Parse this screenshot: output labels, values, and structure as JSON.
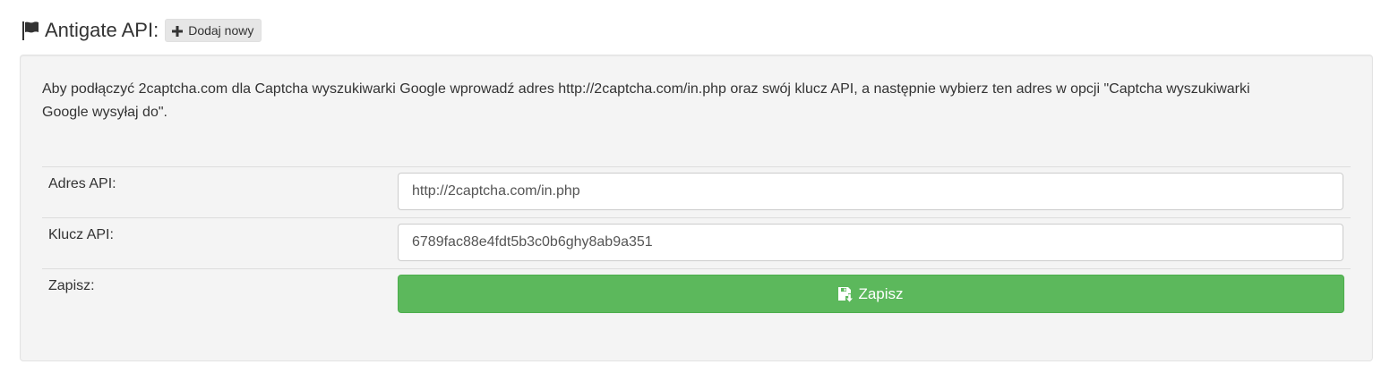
{
  "header": {
    "title": "Antigate API:",
    "add_button_label": "Dodaj nowy",
    "flag_icon": "flag-icon",
    "plus_icon": "plus-icon"
  },
  "panel": {
    "description": "Aby podłączyć 2captcha.com dla Captcha wyszukiwarki Google wprowadź adres http://2captcha.com/in.php oraz swój klucz API, a następnie wybierz ten adres w opcji \"Captcha wyszukiwarki Google wysyłaj do\".",
    "api_address": {
      "label": "Adres API:",
      "value": "http://2captcha.com/in.php"
    },
    "api_key": {
      "label": "Klucz API:",
      "value": "6789fac88e4fdt5b3c0b6ghy8ab9a351"
    },
    "save": {
      "label": "Zapisz:",
      "button_label": "Zapisz",
      "icon": "save-icon"
    }
  },
  "colors": {
    "success": "#5cb85c",
    "panel_bg": "#f4f4f4",
    "text": "#333333"
  }
}
